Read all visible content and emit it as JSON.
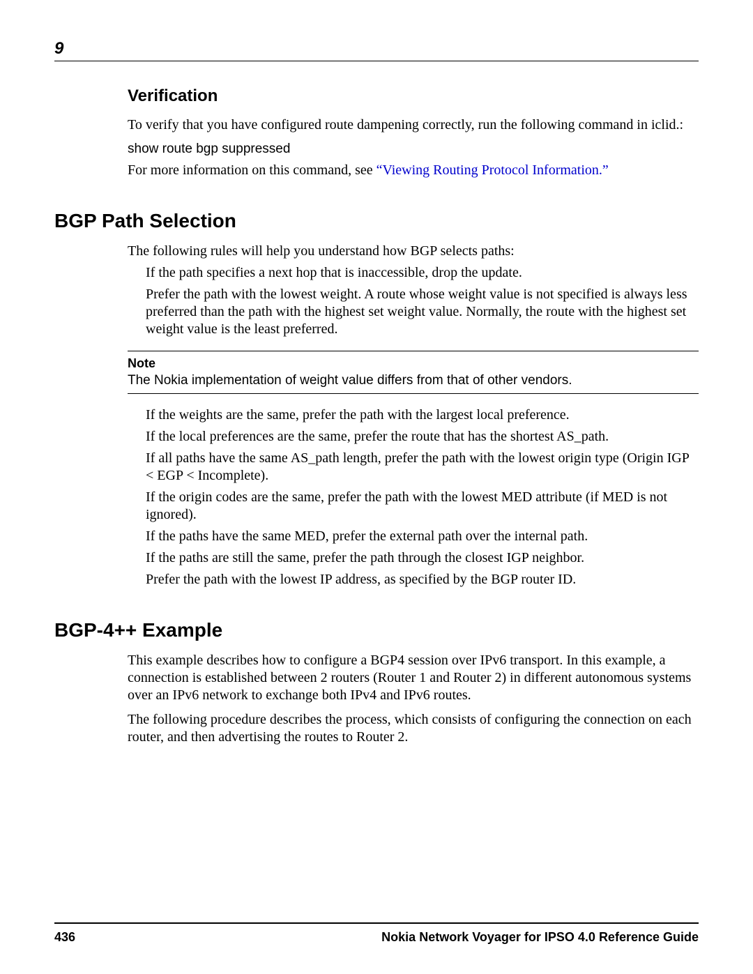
{
  "chapter": "9",
  "verification": {
    "heading": "Verification",
    "para1": "To verify that you have configured route dampening correctly, run the following command in iclid.:",
    "command": "show route bgp suppressed",
    "para2_prefix": "For more information on this command, see ",
    "para2_link": "“Viewing Routing Protocol Information.”"
  },
  "path_selection": {
    "heading": "BGP Path Selection",
    "intro": "The following rules will help you understand how BGP selects paths:",
    "rules_a": [
      "If the path specifies a next hop that is inaccessible, drop the update.",
      "Prefer the path with the lowest weight. A route whose weight value is not specified is always less preferred than the path with the highest set weight value. Normally, the route with the highest set weight value is the least preferred."
    ],
    "note_label": "Note",
    "note_text": "The Nokia implementation of weight value differs from that of other vendors.",
    "rules_b": [
      "If the weights are the same, prefer the path with the largest local preference.",
      "If the local preferences are the same, prefer the route that has the shortest AS_path.",
      "If all paths have the same AS_path length, prefer the path with the lowest origin type (Origin IGP < EGP < Incomplete).",
      "If the origin codes are the same, prefer the path with the lowest MED attribute (if MED is not ignored).",
      "If the paths have the same MED, prefer the external path over the internal path.",
      "If the paths are still the same, prefer the path through the closest IGP neighbor.",
      "Prefer the path with the lowest IP address, as specified by the BGP router ID."
    ]
  },
  "example": {
    "heading": "BGP-4++ Example",
    "para1": "This example describes how to configure a BGP4 session over IPv6 transport. In this example, a connection is established between 2 routers (Router 1 and Router 2) in different autonomous systems over an IPv6 network to exchange both IPv4 and IPv6 routes.",
    "para2": "The following procedure describes the process, which consists of configuring the connection on each router, and then advertising the routes to Router 2."
  },
  "footer": {
    "page": "436",
    "title": "Nokia Network Voyager for IPSO 4.0 Reference Guide"
  }
}
